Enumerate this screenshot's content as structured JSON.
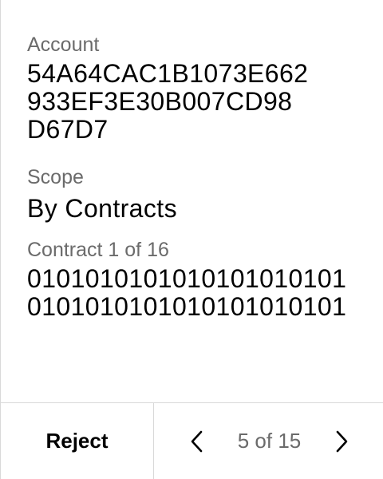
{
  "fields": {
    "account": {
      "label": "Account",
      "lines": [
        "54A64CAC1B1073E662",
        "933EF3E30B007CD98",
        "D67D7"
      ]
    },
    "scope": {
      "label": "Scope",
      "value": "By Contracts"
    },
    "contract": {
      "label": "Contract 1 of 16",
      "lines": [
        "0101010101010101010101",
        "0101010101010101010101"
      ]
    }
  },
  "footer": {
    "reject_label": "Reject",
    "page_indicator": "5 of 15"
  },
  "icons": {
    "previous": "chevron-left-icon",
    "next": "chevron-right-icon"
  }
}
